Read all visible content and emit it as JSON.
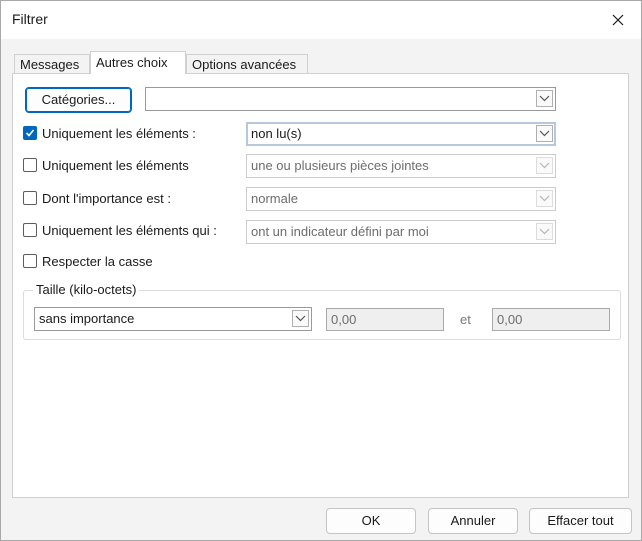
{
  "window": {
    "title": "Filtrer"
  },
  "tabs": [
    {
      "label": "Messages"
    },
    {
      "label": "Autres choix"
    },
    {
      "label": "Options avancées"
    }
  ],
  "categories": {
    "button_label": "Catégories...",
    "value": ""
  },
  "rows": [
    {
      "label": "Uniquement les éléments :",
      "checked": true,
      "value": "non lu(s)",
      "enabled": true
    },
    {
      "label": "Uniquement les éléments",
      "checked": false,
      "value": "une ou plusieurs pièces jointes",
      "enabled": false
    },
    {
      "label": "Dont l'importance est :",
      "checked": false,
      "value": "normale",
      "enabled": false
    },
    {
      "label": "Uniquement les éléments qui :",
      "checked": false,
      "value": "ont un indicateur défini par moi",
      "enabled": false
    }
  ],
  "match_case": {
    "label": "Respecter la casse",
    "checked": false
  },
  "size_group": {
    "title": "Taille (kilo-octets)",
    "condition": "sans importance",
    "min": "0,00",
    "between_label": "et",
    "max": "0,00"
  },
  "footer": {
    "ok_label": "OK",
    "cancel_label": "Annuler",
    "clear_label": "Effacer tout"
  },
  "colors": {
    "accent": "#0067c0",
    "panel": "#ffffff",
    "dialog": "#f3f3f3"
  },
  "icons": {
    "close": "close-icon",
    "dropdown": "chevron-down-icon",
    "check": "checkmark-icon"
  }
}
